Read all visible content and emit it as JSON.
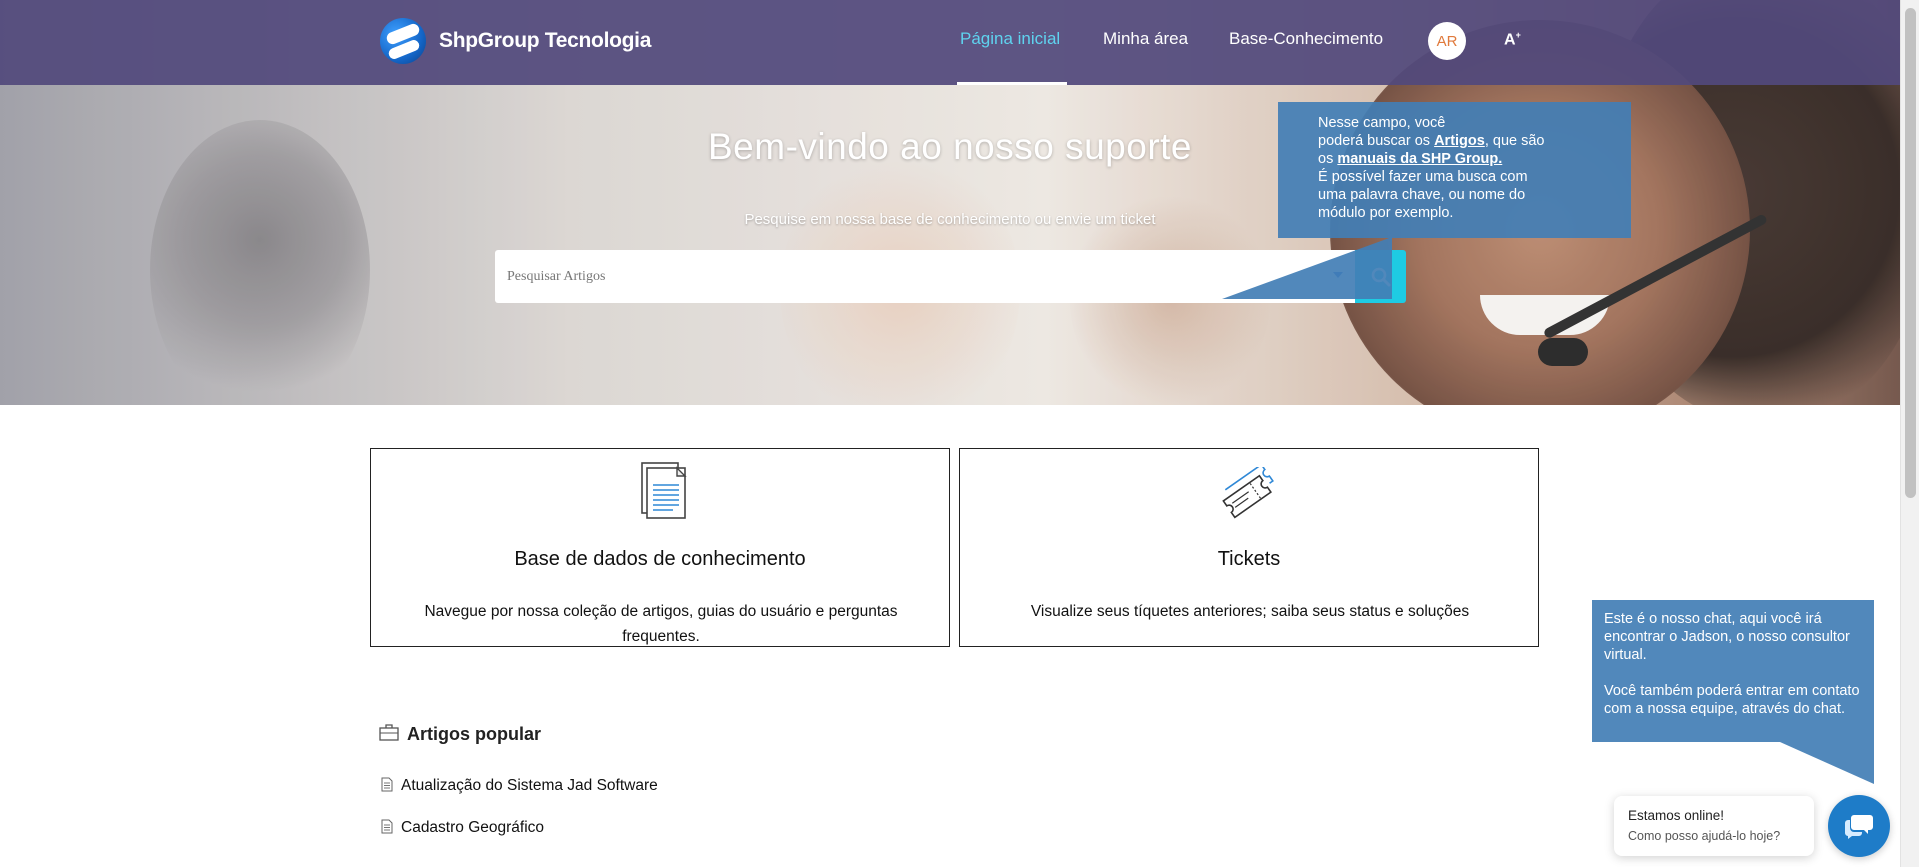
{
  "brand": {
    "name": "ShpGroup Tecnologia"
  },
  "nav": {
    "items": [
      {
        "label": "Página inicial",
        "active": true
      },
      {
        "label": "Minha área",
        "active": false
      },
      {
        "label": "Base-Conhecimento",
        "active": false
      }
    ],
    "avatar_initials": "AR",
    "accessibility_label": "A"
  },
  "hero": {
    "title": "Bem-vindo ao nosso suporte",
    "subtitle": "Pesquise em nossa base de conhecimento ou envie um ticket",
    "search_placeholder": "Pesquisar Artigos"
  },
  "tooltip_search": {
    "line1": "Nesse campo, você",
    "line2_prefix": "poderá buscar os ",
    "line2_link": "Artigos",
    "line2_suffix": ", que são",
    "line3_prefix": "os ",
    "line3_link": "manuais da SHP Group.",
    "line4": "É possível fazer uma busca com",
    "line5": "uma palavra chave, ou nome do",
    "line6": "módulo por exemplo."
  },
  "tooltip_chat": {
    "para1": "Este é o nosso chat, aqui você irá encontrar o Jadson, o nosso consultor virtual.",
    "para2": "Você também poderá entrar em contato com a nossa equipe, através do chat."
  },
  "cards": [
    {
      "icon": "document-icon",
      "title": "Base de dados de conhecimento",
      "description": "Navegue por nossa coleção de artigos, guias do usuário e perguntas frequentes."
    },
    {
      "icon": "tickets-icon",
      "title": "Tickets",
      "description": "Visualize seus tíquetes anteriores; saiba seus status e soluções"
    }
  ],
  "popular": {
    "title": "Artigos popular",
    "articles": [
      "Atualização do Sistema Jad Software",
      "Cadastro Geográfico"
    ]
  },
  "chat": {
    "status": "Estamos online!",
    "prompt": "Como posso ajudá-lo hoje?"
  },
  "colors": {
    "nav_bg": "#52497c",
    "accent_cyan": "#1ecbe3",
    "tooltip_blue": "#427eb5",
    "chat_blue": "#1e7cc8"
  }
}
